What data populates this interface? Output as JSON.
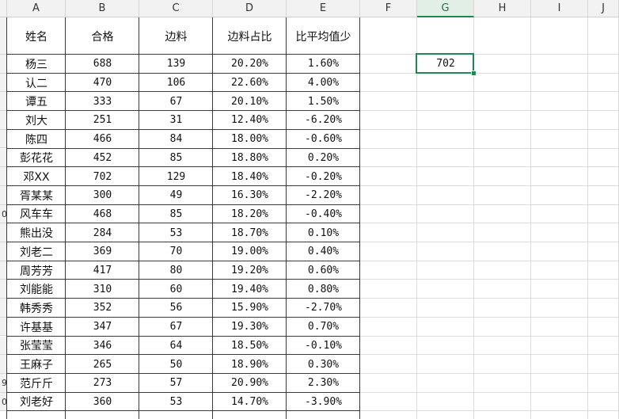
{
  "columns": [
    "A",
    "B",
    "C",
    "D",
    "E",
    "F",
    "G",
    "H",
    "I",
    "J"
  ],
  "selected_column": "G",
  "row_numbers": [
    "",
    "",
    "",
    "",
    "",
    "",
    "",
    "",
    "",
    "0",
    "",
    "",
    "",
    "",
    "",
    "",
    "",
    "",
    "9",
    "0"
  ],
  "table": {
    "headers": [
      "姓名",
      "合格",
      "边料",
      "边料占比",
      "比平均值少"
    ],
    "rows": [
      [
        "杨三",
        "688",
        "139",
        "20.20%",
        "1.60%"
      ],
      [
        "认二",
        "470",
        "106",
        "22.60%",
        "4.00%"
      ],
      [
        "谭五",
        "333",
        "67",
        "20.10%",
        "1.50%"
      ],
      [
        "刘大",
        "251",
        "31",
        "12.40%",
        "-6.20%"
      ],
      [
        "陈四",
        "466",
        "84",
        "18.00%",
        "-0.60%"
      ],
      [
        "彭花花",
        "452",
        "85",
        "18.80%",
        "0.20%"
      ],
      [
        "邓XX",
        "702",
        "129",
        "18.40%",
        "-0.20%"
      ],
      [
        "胥某某",
        "300",
        "49",
        "16.30%",
        "-2.20%"
      ],
      [
        "风车车",
        "468",
        "85",
        "18.20%",
        "-0.40%"
      ],
      [
        "熊出没",
        "284",
        "53",
        "18.70%",
        "0.10%"
      ],
      [
        "刘老二",
        "369",
        "70",
        "19.00%",
        "0.40%"
      ],
      [
        "周芳芳",
        "417",
        "80",
        "19.20%",
        "0.60%"
      ],
      [
        "刘能能",
        "310",
        "60",
        "19.40%",
        "0.80%"
      ],
      [
        "韩秀秀",
        "352",
        "56",
        "15.90%",
        "-2.70%"
      ],
      [
        "许基基",
        "347",
        "67",
        "19.30%",
        "0.70%"
      ],
      [
        "张莹莹",
        "346",
        "64",
        "18.50%",
        "-0.10%"
      ],
      [
        "王麻子",
        "265",
        "50",
        "18.90%",
        "0.30%"
      ],
      [
        "范斤斤",
        "273",
        "57",
        "20.90%",
        "2.30%"
      ],
      [
        "刘老好",
        "360",
        "53",
        "14.70%",
        "-3.90%"
      ]
    ]
  },
  "active_cell": {
    "ref": "G2",
    "value": "702"
  },
  "colors": {
    "selection": "#1e8a50",
    "header_bg": "#f2f2f2",
    "grid": "#dcdcdc"
  }
}
